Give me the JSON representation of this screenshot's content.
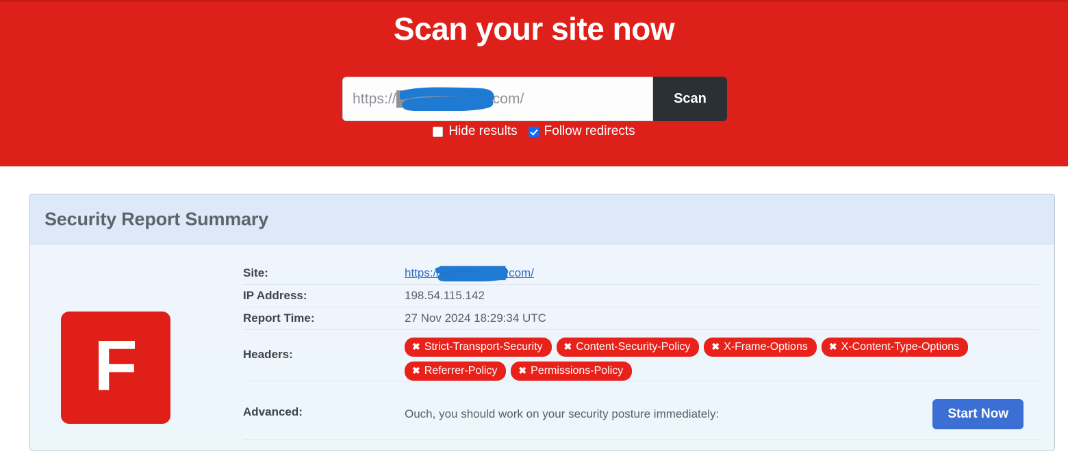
{
  "hero": {
    "title": "Scan your site now",
    "background_color": "#dd2019",
    "url_value": "https://█████████.com/",
    "url_prefix": "https://",
    "url_suffix": ".com/",
    "url_placeholder": "https://example.com/",
    "scan_button": "Scan",
    "scan_button_color": "#2b3035",
    "options": [
      {
        "label": "Hide results",
        "checked": false
      },
      {
        "label": "Follow redirects",
        "checked": true
      }
    ],
    "checkbox_accent": "#0d6efd"
  },
  "report": {
    "panel_title": "Security Report Summary",
    "grade": "F",
    "grade_color": "#e01f19",
    "rows": {
      "site_label": "Site:",
      "site_value": "https://████████.com/",
      "site_prefix": "https:/",
      "site_suffix": ".com/",
      "ip_label": "IP Address:",
      "ip_value": "198.54.115.142",
      "time_label": "Report Time:",
      "time_value": "27 Nov 2024 18:29:34 UTC",
      "headers_label": "Headers:",
      "advanced_label": "Advanced:",
      "advanced_text": "Ouch, you should work on your security posture immediately:",
      "start_button": "Start Now",
      "start_button_color": "#3b6fd4"
    },
    "missing_headers": [
      "Strict-Transport-Security",
      "Content-Security-Policy",
      "X-Frame-Options",
      "X-Content-Type-Options",
      "Referrer-Policy",
      "Permissions-Policy"
    ],
    "badge_icon": "✖",
    "badge_color": "#e8221a"
  }
}
